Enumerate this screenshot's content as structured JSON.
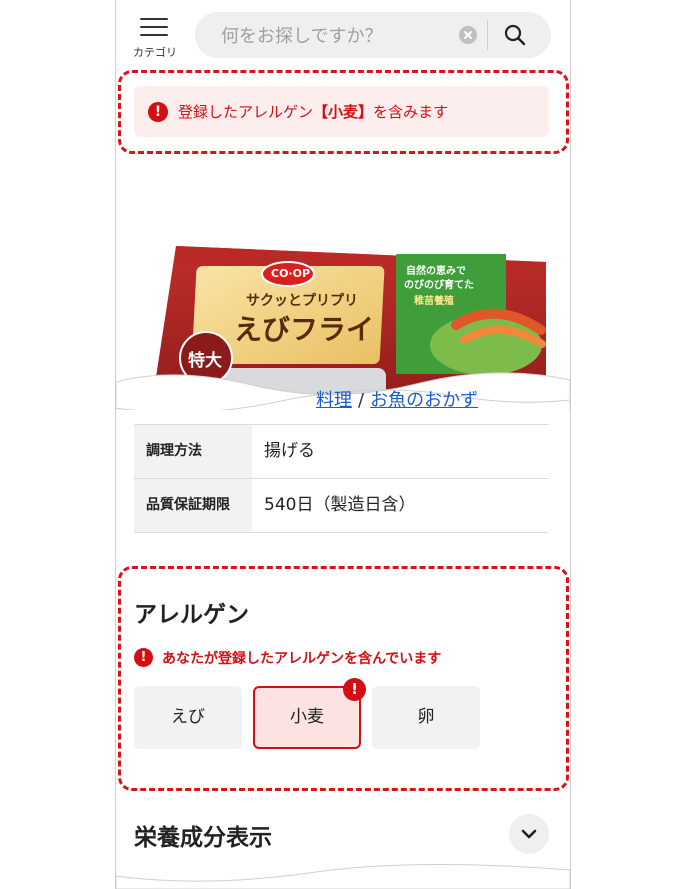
{
  "header": {
    "menu_label": "カテゴリ",
    "search_placeholder": "何をお探しですか？"
  },
  "alert": {
    "prefix": "登録したアレルゲン",
    "allergen": "【小麦】",
    "suffix": "を含みます"
  },
  "product_image": {
    "brand": "CO·OP",
    "catch": "サクッとプリプリ",
    "name": "えびフライ",
    "badge": "特大",
    "side_note_1": "自然の恵みで",
    "side_note_2": "のびのび育てた",
    "side_note_3": "稚苗養殖"
  },
  "details": {
    "breadcrumb_partial": "料理",
    "breadcrumb_sep": "/",
    "breadcrumb_link": "お魚のおかず",
    "rows": [
      {
        "key": "調理方法",
        "value": "揚げる"
      },
      {
        "key": "品質保証期限",
        "value": "540日（製造日含）"
      }
    ]
  },
  "allergen": {
    "title": "アレルゲン",
    "warning": "あなたが登録したアレルゲンを含んでいます",
    "items": [
      {
        "label": "えび",
        "matched": false
      },
      {
        "label": "小麦",
        "matched": true
      },
      {
        "label": "卵",
        "matched": false
      }
    ],
    "badge": "!"
  },
  "nutrition": {
    "title": "栄養成分表示"
  },
  "colors": {
    "accent": "#d40f14",
    "alert_bg": "#fdeeee",
    "link": "#1a5fc8"
  }
}
